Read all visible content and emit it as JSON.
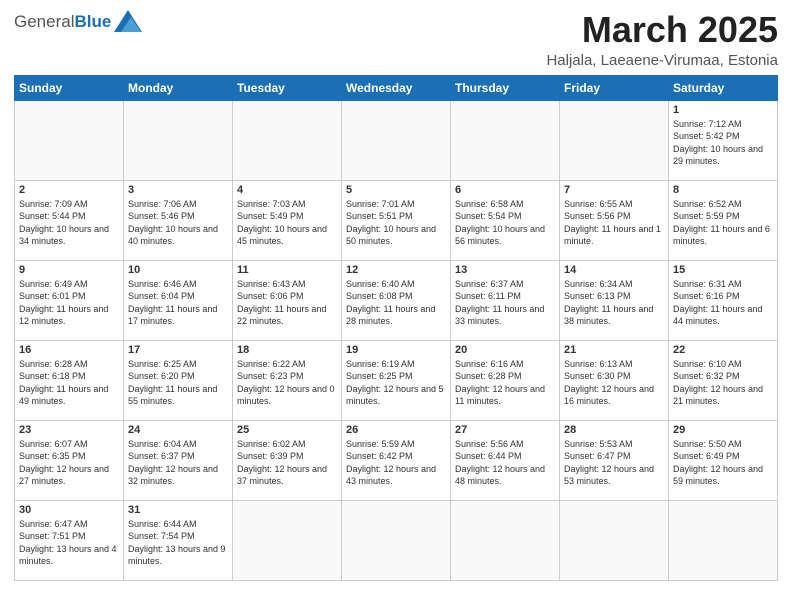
{
  "logo": {
    "general": "General",
    "blue": "Blue"
  },
  "header": {
    "month": "March 2025",
    "location": "Haljala, Laeaene-Virumaa, Estonia"
  },
  "weekdays": [
    "Sunday",
    "Monday",
    "Tuesday",
    "Wednesday",
    "Thursday",
    "Friday",
    "Saturday"
  ],
  "weeks": [
    [
      {
        "day": "",
        "info": ""
      },
      {
        "day": "",
        "info": ""
      },
      {
        "day": "",
        "info": ""
      },
      {
        "day": "",
        "info": ""
      },
      {
        "day": "",
        "info": ""
      },
      {
        "day": "",
        "info": ""
      },
      {
        "day": "1",
        "info": "Sunrise: 7:12 AM\nSunset: 5:42 PM\nDaylight: 10 hours and 29 minutes."
      }
    ],
    [
      {
        "day": "2",
        "info": "Sunrise: 7:09 AM\nSunset: 5:44 PM\nDaylight: 10 hours and 34 minutes."
      },
      {
        "day": "3",
        "info": "Sunrise: 7:06 AM\nSunset: 5:46 PM\nDaylight: 10 hours and 40 minutes."
      },
      {
        "day": "4",
        "info": "Sunrise: 7:03 AM\nSunset: 5:49 PM\nDaylight: 10 hours and 45 minutes."
      },
      {
        "day": "5",
        "info": "Sunrise: 7:01 AM\nSunset: 5:51 PM\nDaylight: 10 hours and 50 minutes."
      },
      {
        "day": "6",
        "info": "Sunrise: 6:58 AM\nSunset: 5:54 PM\nDaylight: 10 hours and 56 minutes."
      },
      {
        "day": "7",
        "info": "Sunrise: 6:55 AM\nSunset: 5:56 PM\nDaylight: 11 hours and 1 minute."
      },
      {
        "day": "8",
        "info": "Sunrise: 6:52 AM\nSunset: 5:59 PM\nDaylight: 11 hours and 6 minutes."
      }
    ],
    [
      {
        "day": "9",
        "info": "Sunrise: 6:49 AM\nSunset: 6:01 PM\nDaylight: 11 hours and 12 minutes."
      },
      {
        "day": "10",
        "info": "Sunrise: 6:46 AM\nSunset: 6:04 PM\nDaylight: 11 hours and 17 minutes."
      },
      {
        "day": "11",
        "info": "Sunrise: 6:43 AM\nSunset: 6:06 PM\nDaylight: 11 hours and 22 minutes."
      },
      {
        "day": "12",
        "info": "Sunrise: 6:40 AM\nSunset: 6:08 PM\nDaylight: 11 hours and 28 minutes."
      },
      {
        "day": "13",
        "info": "Sunrise: 6:37 AM\nSunset: 6:11 PM\nDaylight: 11 hours and 33 minutes."
      },
      {
        "day": "14",
        "info": "Sunrise: 6:34 AM\nSunset: 6:13 PM\nDaylight: 11 hours and 38 minutes."
      },
      {
        "day": "15",
        "info": "Sunrise: 6:31 AM\nSunset: 6:16 PM\nDaylight: 11 hours and 44 minutes."
      }
    ],
    [
      {
        "day": "16",
        "info": "Sunrise: 6:28 AM\nSunset: 6:18 PM\nDaylight: 11 hours and 49 minutes."
      },
      {
        "day": "17",
        "info": "Sunrise: 6:25 AM\nSunset: 6:20 PM\nDaylight: 11 hours and 55 minutes."
      },
      {
        "day": "18",
        "info": "Sunrise: 6:22 AM\nSunset: 6:23 PM\nDaylight: 12 hours and 0 minutes."
      },
      {
        "day": "19",
        "info": "Sunrise: 6:19 AM\nSunset: 6:25 PM\nDaylight: 12 hours and 5 minutes."
      },
      {
        "day": "20",
        "info": "Sunrise: 6:16 AM\nSunset: 6:28 PM\nDaylight: 12 hours and 11 minutes."
      },
      {
        "day": "21",
        "info": "Sunrise: 6:13 AM\nSunset: 6:30 PM\nDaylight: 12 hours and 16 minutes."
      },
      {
        "day": "22",
        "info": "Sunrise: 6:10 AM\nSunset: 6:32 PM\nDaylight: 12 hours and 21 minutes."
      }
    ],
    [
      {
        "day": "23",
        "info": "Sunrise: 6:07 AM\nSunset: 6:35 PM\nDaylight: 12 hours and 27 minutes."
      },
      {
        "day": "24",
        "info": "Sunrise: 6:04 AM\nSunset: 6:37 PM\nDaylight: 12 hours and 32 minutes."
      },
      {
        "day": "25",
        "info": "Sunrise: 6:02 AM\nSunset: 6:39 PM\nDaylight: 12 hours and 37 minutes."
      },
      {
        "day": "26",
        "info": "Sunrise: 5:59 AM\nSunset: 6:42 PM\nDaylight: 12 hours and 43 minutes."
      },
      {
        "day": "27",
        "info": "Sunrise: 5:56 AM\nSunset: 6:44 PM\nDaylight: 12 hours and 48 minutes."
      },
      {
        "day": "28",
        "info": "Sunrise: 5:53 AM\nSunset: 6:47 PM\nDaylight: 12 hours and 53 minutes."
      },
      {
        "day": "29",
        "info": "Sunrise: 5:50 AM\nSunset: 6:49 PM\nDaylight: 12 hours and 59 minutes."
      }
    ],
    [
      {
        "day": "30",
        "info": "Sunrise: 6:47 AM\nSunset: 7:51 PM\nDaylight: 13 hours and 4 minutes."
      },
      {
        "day": "31",
        "info": "Sunrise: 6:44 AM\nSunset: 7:54 PM\nDaylight: 13 hours and 9 minutes."
      },
      {
        "day": "",
        "info": ""
      },
      {
        "day": "",
        "info": ""
      },
      {
        "day": "",
        "info": ""
      },
      {
        "day": "",
        "info": ""
      },
      {
        "day": "",
        "info": ""
      }
    ]
  ]
}
